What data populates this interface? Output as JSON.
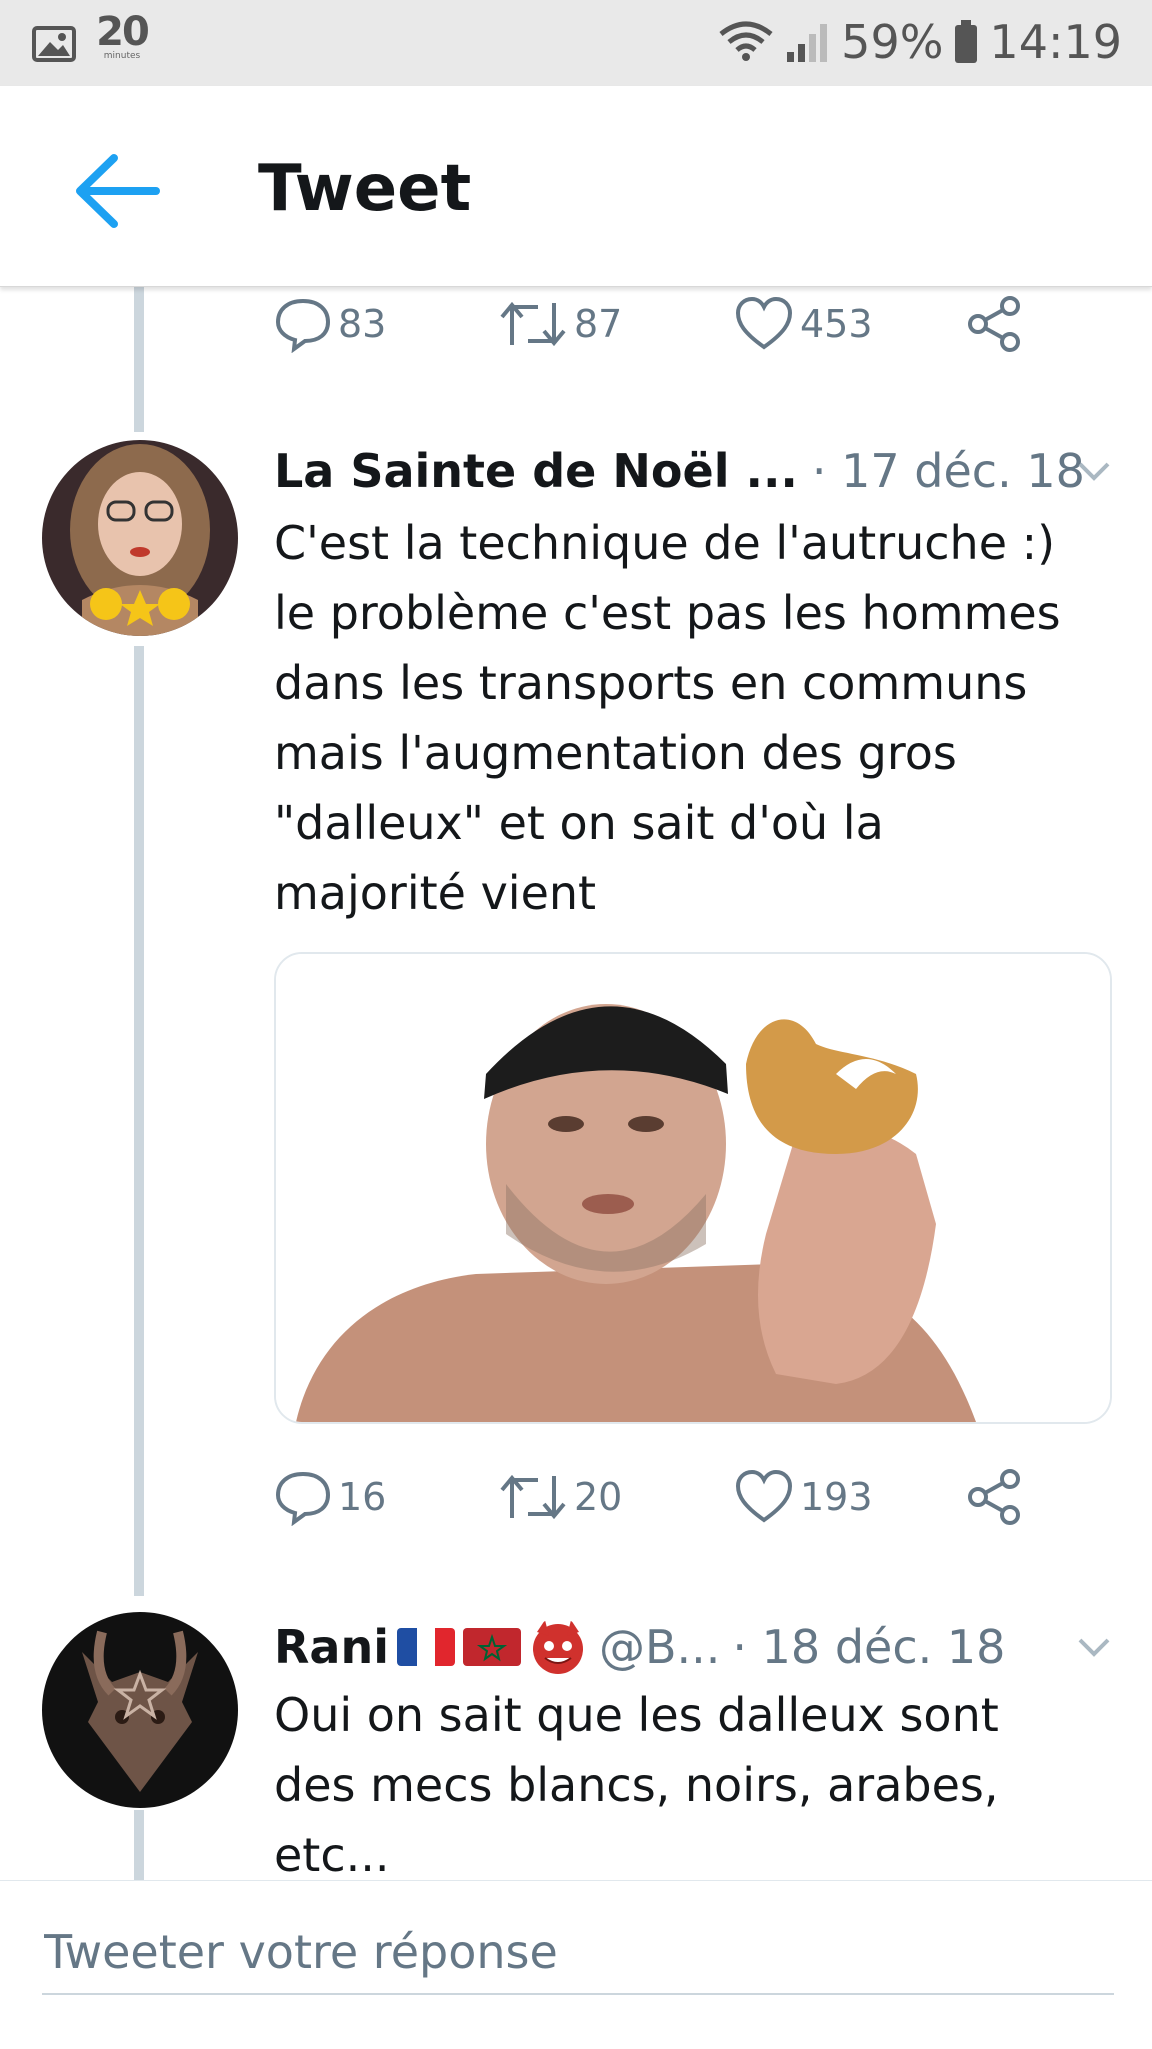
{
  "status_bar": {
    "app_badge": "20",
    "app_badge_sub": "minutes",
    "battery": "59%",
    "time": "14:19"
  },
  "header": {
    "title": "Tweet"
  },
  "prev_tweet": {
    "replies": "83",
    "retweets": "87",
    "likes": "453"
  },
  "tweets": [
    {
      "name": "La Sainte de Noël ...",
      "date": "· 17 déc. 18",
      "text": "C'est la technique de l'autruche :)\nle problème c'est pas les hommes\ndans les transports en communs\nmais l'augmentation des gros\n\"dalleux\" et on sait d'où la\nmajorité vient",
      "replies": "16",
      "retweets": "20",
      "likes": "193"
    },
    {
      "name": "Rani",
      "handle": "@B...",
      "date": "· 18 déc. 18",
      "text": "Oui on sait que les dalleux sont\ndes mecs blancs, noirs, arabes,\netc..."
    }
  ],
  "reply_bar": {
    "placeholder": "Tweeter votre réponse"
  },
  "colors": {
    "accent": "#1da1f2",
    "muted": "#657786",
    "thread_line": "#ccd6dd",
    "status_bar": "#e9e9e9"
  },
  "icons": [
    "image-icon",
    "wifi-icon",
    "signal-icon",
    "battery-icon",
    "back-arrow-icon",
    "reply-icon",
    "retweet-icon",
    "like-icon",
    "share-icon",
    "chevron-down-icon",
    "france-flag-icon",
    "morocco-flag-icon",
    "demon-emoji-icon"
  ]
}
